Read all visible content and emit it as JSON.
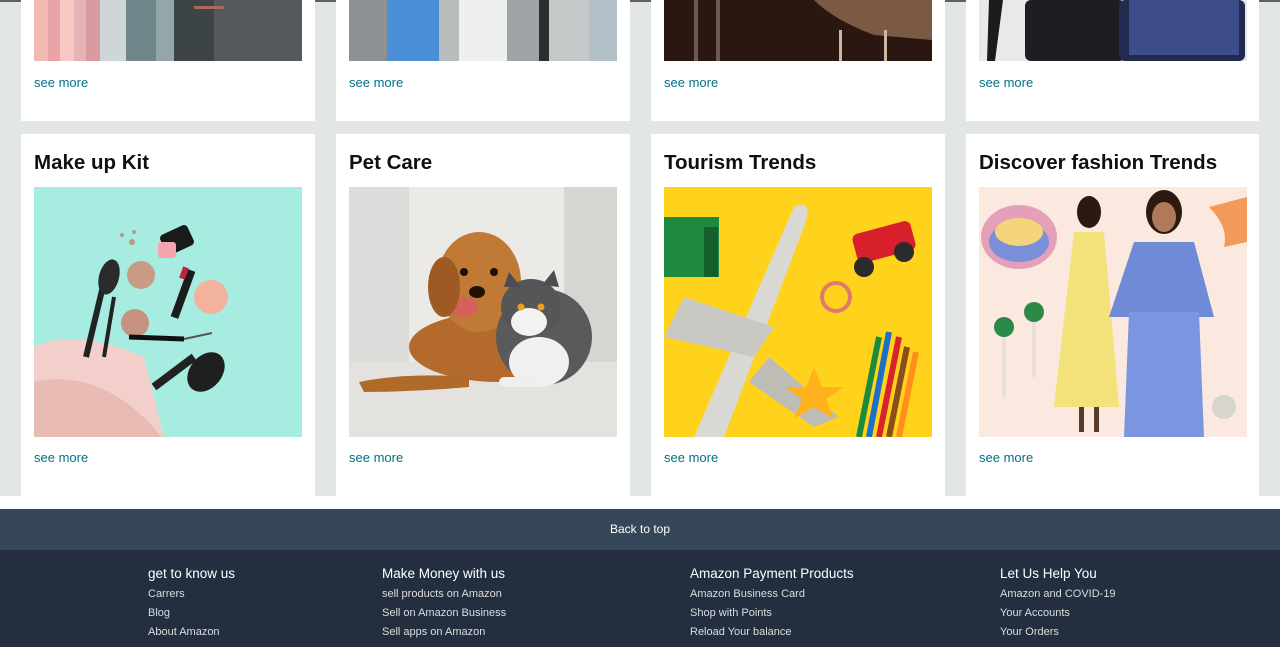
{
  "top_row": {
    "cards": [
      {
        "see_more": "see more"
      },
      {
        "see_more": "see more"
      },
      {
        "see_more": "see more"
      },
      {
        "see_more": "see more"
      }
    ]
  },
  "main_row": {
    "cards": [
      {
        "title": "Make up Kit",
        "see_more": "see more",
        "image": "makeup-kit-image"
      },
      {
        "title": "Pet Care",
        "see_more": "see more",
        "image": "dog-and-cat-image"
      },
      {
        "title": "Tourism Trends",
        "see_more": "see more",
        "image": "toy-plane-and-pencils-image"
      },
      {
        "title": "Discover fashion Trends",
        "see_more": "see more",
        "image": "fashion-models-image"
      }
    ]
  },
  "back_to_top": "Back to top",
  "footer": {
    "columns": [
      {
        "heading": "get to know us",
        "links": [
          "Carrers",
          "Blog",
          "About Amazon"
        ]
      },
      {
        "heading": "Make Money with us",
        "links": [
          "sell products on Amazon",
          "Sell on Amazon Business",
          "Sell apps on Amazon"
        ]
      },
      {
        "heading": "Amazon Payment Products",
        "links": [
          "Amazon Business Card",
          "Shop with Points",
          "Reload Your balance"
        ]
      },
      {
        "heading": "Let Us Help You",
        "links": [
          "Amazon and COVID-19",
          "Your Accounts",
          "Your Orders"
        ]
      }
    ]
  },
  "colors": {
    "page_bg": "#e3e6e6",
    "link": "#007185",
    "back_to_top_bg": "#37475a",
    "footer_bg": "#232f3e"
  }
}
